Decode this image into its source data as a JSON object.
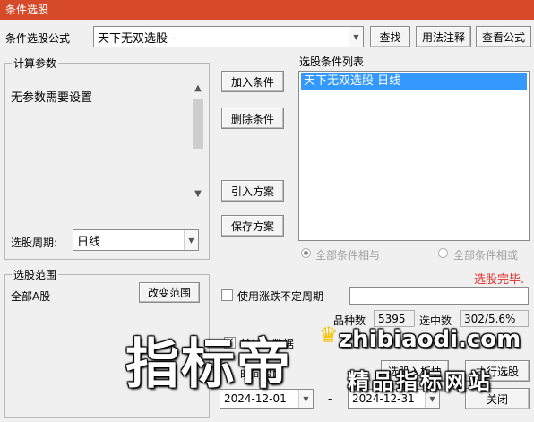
{
  "window": {
    "title": "条件选股"
  },
  "formula": {
    "label": "条件选股公式",
    "value": "天下无双选股  -",
    "find_button": "查找",
    "usage_button": "用法注释",
    "view_button": "查看公式"
  },
  "params": {
    "group_title": "计算参数",
    "message": "无参数需要设置",
    "period_label": "选股周期:",
    "period_value": "日线"
  },
  "actions": {
    "add_condition": "加入条件",
    "delete_condition": "删除条件",
    "import_scheme": "引入方案",
    "save_scheme": "保存方案"
  },
  "conditions": {
    "title": "选股条件列表",
    "items": [
      "天下无双选股  日线"
    ],
    "radio_and": "全部条件相与",
    "radio_or": "全部条件相或",
    "status": "选股完毕."
  },
  "range": {
    "group_title": "选股范围",
    "value": "全部A股",
    "change_button": "改变范围"
  },
  "options": {
    "use_period_label": "使用涨跌不定周期",
    "use_period_value": ""
  },
  "stats": {
    "count_label": "品种数",
    "count_value": "5395",
    "selected_label": "选中数",
    "selected_value": "302/5.6%"
  },
  "bottom": {
    "fuquan_label": "前复权数据",
    "date_range_label": "时间段内",
    "date_start": "2024-12-01",
    "date_separator": "-",
    "date_end": "2024-12-31",
    "select_to_block_button": "选股入板块",
    "execute_button": "执行选股",
    "close_button": "关闭"
  },
  "watermark": {
    "main": "指标帝",
    "domain": "zhibiaodi.com",
    "sub": "精品指标网站"
  },
  "colors": {
    "title_bar": "#d64a2a",
    "selection": "#3399ff",
    "status": "#e0302a"
  }
}
